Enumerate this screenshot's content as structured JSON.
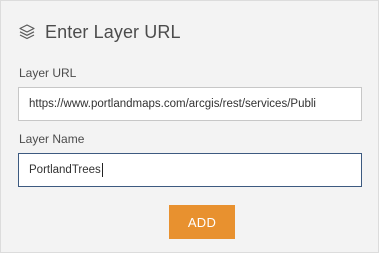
{
  "header": {
    "icon": "layers-icon",
    "title": "Enter Layer URL"
  },
  "form": {
    "url_label": "Layer URL",
    "url_value": "https://www.portlandmaps.com/arcgis/rest/services/Publi",
    "name_label": "Layer Name",
    "name_value": "PortlandTrees"
  },
  "actions": {
    "add_label": "ADD"
  },
  "colors": {
    "accent": "#e8912f",
    "focus_border": "#3d5a80",
    "panel_bg": "#f3f3f3"
  }
}
